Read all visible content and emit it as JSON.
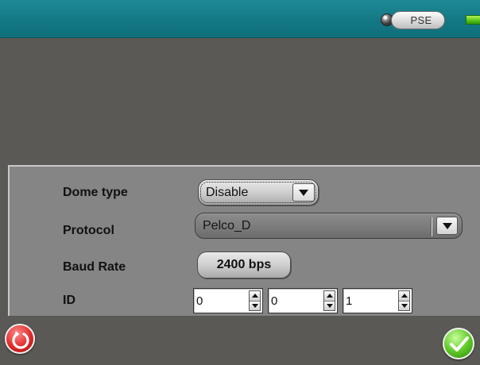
{
  "status_bar": {
    "pse_label": "PSE",
    "icons": [
      "status-led-icon",
      "battery-icon"
    ],
    "colors": {
      "bar": "#137884",
      "battery": "#55c21a"
    }
  },
  "settings": {
    "dome_type": {
      "label": "Dome type",
      "value": "Disable"
    },
    "protocol": {
      "label": "Protocol",
      "value": "Pelco_D"
    },
    "baud_rate": {
      "label": "Baud Rate",
      "value": "2400 bps"
    },
    "id": {
      "label": "ID",
      "values": [
        "0",
        "0",
        "1"
      ]
    }
  },
  "footer": {
    "icons": [
      "reset-icon",
      "checkmark-icon"
    ],
    "colors": {
      "reset": "#e22a2a",
      "confirm": "#5cc425"
    }
  }
}
